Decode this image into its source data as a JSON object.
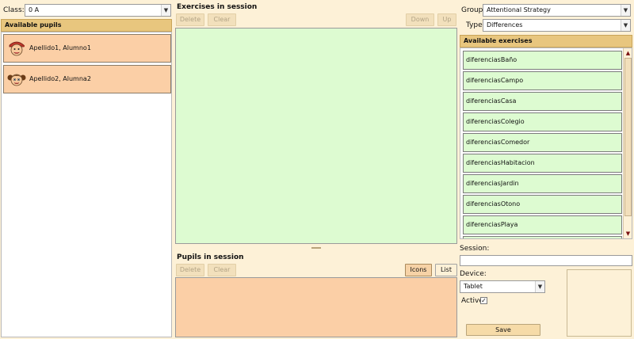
{
  "class_selector": {
    "label": "Class:",
    "value": "0 A"
  },
  "available_pupils": {
    "title": "Available pupils",
    "pupils": [
      {
        "name": "Apellido1, Alumno1",
        "avatar": "boy-avatar-icon"
      },
      {
        "name": "Apellido2, Alumna2",
        "avatar": "girl-avatar-icon"
      }
    ]
  },
  "exercises_in_session": {
    "title": "Exercises in session",
    "delete_label": "Delete",
    "clear_label": "Clear",
    "down_label": "Down",
    "up_label": "Up"
  },
  "pupils_in_session": {
    "title": "Pupils in session",
    "delete_label": "Delete",
    "clear_label": "Clear",
    "icons_label": "Icons",
    "list_label": "List"
  },
  "filters": {
    "group_label": "Group:",
    "group_value": "Attentional Strategy",
    "type_label": "Type:",
    "type_value": "Differences"
  },
  "available_exercises": {
    "title": "Available exercises",
    "items": [
      "diferenciasBaño",
      "diferenciasCampo",
      "diferenciasCasa",
      "diferenciasColegio",
      "diferenciasComedor",
      "diferenciasHabitacion",
      "diferenciasJardin",
      "diferenciasOtono",
      "diferenciasPlaya"
    ]
  },
  "session_form": {
    "session_label": "Session:",
    "session_value": "",
    "device_label": "Device:",
    "device_value": "Tablet",
    "active_label": "Active:",
    "active_checked": true,
    "save_label": "Save"
  },
  "colors": {
    "background": "#fdf1d7",
    "header_bar": "#e8c67e",
    "pupil_card": "#fbcfa6",
    "exercise_area": "#ddfbd1"
  }
}
